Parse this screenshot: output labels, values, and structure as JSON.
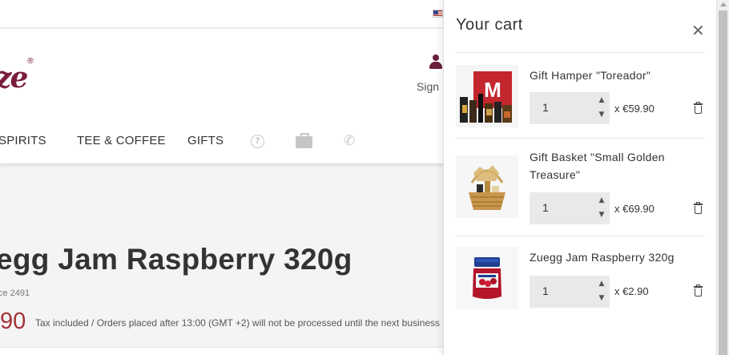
{
  "topbar": {
    "language_flag": "us-flag-icon"
  },
  "header": {
    "logo_reg": "®",
    "logo_text": "ze",
    "sign_in_label": "Sign"
  },
  "nav": {
    "items": [
      "SPIRITS",
      "TEE & COFFEE",
      "GIFTS"
    ],
    "icons": [
      "help-icon",
      "briefcase-icon",
      "phone-icon"
    ],
    "help_glyph": "?",
    "phone_glyph": "✆"
  },
  "product": {
    "title": "egg Jam Raspberry 320g",
    "reference": "ce 2491",
    "price": "90",
    "tax_note": "Tax included / Orders placed after 13:00 (GMT +2) will not be processed until the next business"
  },
  "cart": {
    "title": "Your cart",
    "close_glyph": "✕",
    "items": [
      {
        "name": "Gift Hamper \"Toreador\"",
        "quantity": "1",
        "price": "x €59.90"
      },
      {
        "name": "Gift Basket \"Small Golden Treasure\"",
        "quantity": "1",
        "price": "x €69.90"
      },
      {
        "name": "Zuegg Jam Raspberry 320g",
        "quantity": "1",
        "price": "x €2.90"
      }
    ],
    "stepper": {
      "up": "▲",
      "down": "▼"
    }
  },
  "colors": {
    "brand": "#7a1d3b",
    "price_red": "#a33238",
    "muted_icon": "#c6c6c6"
  }
}
